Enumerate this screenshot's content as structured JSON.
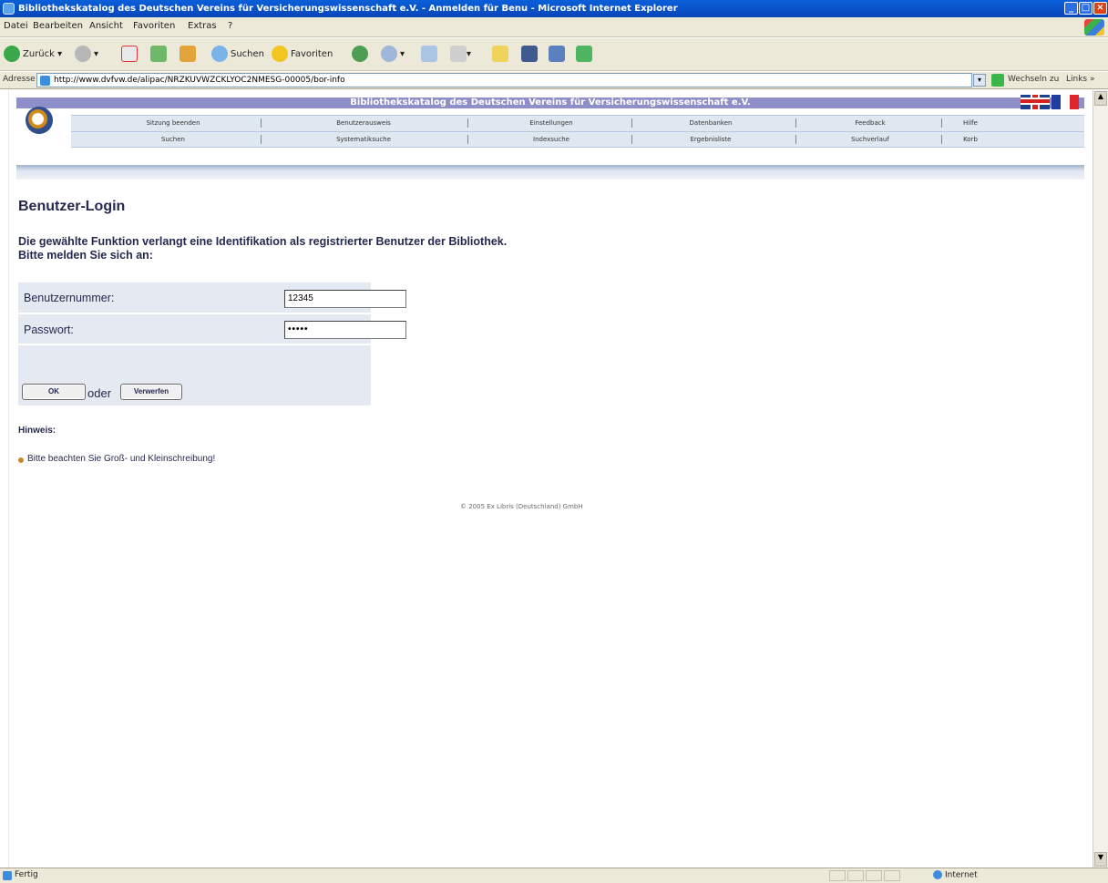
{
  "window": {
    "title": "Bibliothekskatalog des Deutschen Vereins für Versicherungswissenschaft e.V. - Anmelden für Benu - Microsoft Internet Explorer",
    "min": "_",
    "max": "□",
    "close": "×"
  },
  "menu": [
    "Datei",
    "Bearbeiten",
    "Ansicht",
    "Favoriten",
    "Extras",
    "?"
  ],
  "toolbar": {
    "back": "Zurück",
    "search": "Suchen",
    "favorites": "Favoriten"
  },
  "address": {
    "label": "Adresse",
    "url": "http://www.dvfvw.de/alipac/NRZKUVWZCKLYOC2NMESG-00005/bor-info",
    "go": "Wechseln zu",
    "links": "Links »"
  },
  "opac": {
    "banner": "Bibliothekskatalog des Deutschen Vereins für Versicherungswissenschaft e.V.",
    "nav_row1": [
      "Sitzung beenden",
      "Benutzerausweis",
      "Einstellungen",
      "Datenbanken",
      "Feedback",
      "Hilfe"
    ],
    "nav_row2": [
      "Suchen",
      "Systematiksuche",
      "Indexsuche",
      "Ergebnisliste",
      "Suchverlauf",
      "Korb"
    ]
  },
  "login": {
    "title": "Benutzer-Login",
    "message_line1": "Die gewählte Funktion verlangt eine Identifikation als registrierter Benutzer der Bibliothek.",
    "message_line2": "Bitte melden Sie sich an:",
    "user_label": "Benutzernummer:",
    "user_value": "12345",
    "password_label": "Passwort:",
    "password_value": "•••••",
    "ok_label": "OK",
    "or_label": "oder",
    "reset_label": "Verwerfen",
    "hint_title": "Hinweis:",
    "hint_text": "Bitte beachten Sie Groß- und Kleinschreibung!",
    "copyright": "© 2005 Ex Libris (Deutschland) GmbH"
  },
  "status": {
    "text": "Fertig",
    "zone": "Internet"
  }
}
